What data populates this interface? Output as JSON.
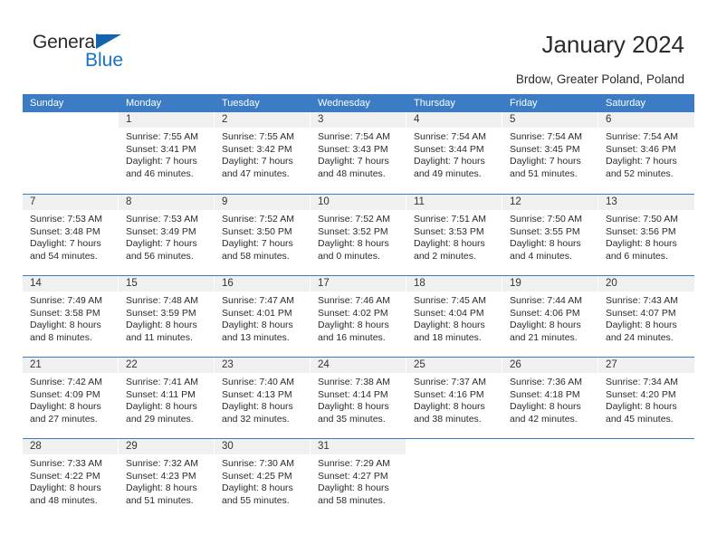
{
  "logo": {
    "text_top": "General",
    "text_bottom": "Blue",
    "triangle_icon": "blue-triangle-icon",
    "color_dark": "#2b2b2b",
    "color_blue": "#1575c4"
  },
  "header": {
    "title": "January 2024",
    "location": "Brdow, Greater Poland, Poland"
  },
  "calendar": {
    "header_bg": "#3b7cc4",
    "header_text_color": "#ffffff",
    "daynum_bg": "#f0f0f0",
    "weekdays": [
      "Sunday",
      "Monday",
      "Tuesday",
      "Wednesday",
      "Thursday",
      "Friday",
      "Saturday"
    ],
    "weeks": [
      [
        {
          "day": "",
          "lines": []
        },
        {
          "day": "1",
          "lines": [
            "Sunrise: 7:55 AM",
            "Sunset: 3:41 PM",
            "Daylight: 7 hours",
            "and 46 minutes."
          ]
        },
        {
          "day": "2",
          "lines": [
            "Sunrise: 7:55 AM",
            "Sunset: 3:42 PM",
            "Daylight: 7 hours",
            "and 47 minutes."
          ]
        },
        {
          "day": "3",
          "lines": [
            "Sunrise: 7:54 AM",
            "Sunset: 3:43 PM",
            "Daylight: 7 hours",
            "and 48 minutes."
          ]
        },
        {
          "day": "4",
          "lines": [
            "Sunrise: 7:54 AM",
            "Sunset: 3:44 PM",
            "Daylight: 7 hours",
            "and 49 minutes."
          ]
        },
        {
          "day": "5",
          "lines": [
            "Sunrise: 7:54 AM",
            "Sunset: 3:45 PM",
            "Daylight: 7 hours",
            "and 51 minutes."
          ]
        },
        {
          "day": "6",
          "lines": [
            "Sunrise: 7:54 AM",
            "Sunset: 3:46 PM",
            "Daylight: 7 hours",
            "and 52 minutes."
          ]
        }
      ],
      [
        {
          "day": "7",
          "lines": [
            "Sunrise: 7:53 AM",
            "Sunset: 3:48 PM",
            "Daylight: 7 hours",
            "and 54 minutes."
          ]
        },
        {
          "day": "8",
          "lines": [
            "Sunrise: 7:53 AM",
            "Sunset: 3:49 PM",
            "Daylight: 7 hours",
            "and 56 minutes."
          ]
        },
        {
          "day": "9",
          "lines": [
            "Sunrise: 7:52 AM",
            "Sunset: 3:50 PM",
            "Daylight: 7 hours",
            "and 58 minutes."
          ]
        },
        {
          "day": "10",
          "lines": [
            "Sunrise: 7:52 AM",
            "Sunset: 3:52 PM",
            "Daylight: 8 hours",
            "and 0 minutes."
          ]
        },
        {
          "day": "11",
          "lines": [
            "Sunrise: 7:51 AM",
            "Sunset: 3:53 PM",
            "Daylight: 8 hours",
            "and 2 minutes."
          ]
        },
        {
          "day": "12",
          "lines": [
            "Sunrise: 7:50 AM",
            "Sunset: 3:55 PM",
            "Daylight: 8 hours",
            "and 4 minutes."
          ]
        },
        {
          "day": "13",
          "lines": [
            "Sunrise: 7:50 AM",
            "Sunset: 3:56 PM",
            "Daylight: 8 hours",
            "and 6 minutes."
          ]
        }
      ],
      [
        {
          "day": "14",
          "lines": [
            "Sunrise: 7:49 AM",
            "Sunset: 3:58 PM",
            "Daylight: 8 hours",
            "and 8 minutes."
          ]
        },
        {
          "day": "15",
          "lines": [
            "Sunrise: 7:48 AM",
            "Sunset: 3:59 PM",
            "Daylight: 8 hours",
            "and 11 minutes."
          ]
        },
        {
          "day": "16",
          "lines": [
            "Sunrise: 7:47 AM",
            "Sunset: 4:01 PM",
            "Daylight: 8 hours",
            "and 13 minutes."
          ]
        },
        {
          "day": "17",
          "lines": [
            "Sunrise: 7:46 AM",
            "Sunset: 4:02 PM",
            "Daylight: 8 hours",
            "and 16 minutes."
          ]
        },
        {
          "day": "18",
          "lines": [
            "Sunrise: 7:45 AM",
            "Sunset: 4:04 PM",
            "Daylight: 8 hours",
            "and 18 minutes."
          ]
        },
        {
          "day": "19",
          "lines": [
            "Sunrise: 7:44 AM",
            "Sunset: 4:06 PM",
            "Daylight: 8 hours",
            "and 21 minutes."
          ]
        },
        {
          "day": "20",
          "lines": [
            "Sunrise: 7:43 AM",
            "Sunset: 4:07 PM",
            "Daylight: 8 hours",
            "and 24 minutes."
          ]
        }
      ],
      [
        {
          "day": "21",
          "lines": [
            "Sunrise: 7:42 AM",
            "Sunset: 4:09 PM",
            "Daylight: 8 hours",
            "and 27 minutes."
          ]
        },
        {
          "day": "22",
          "lines": [
            "Sunrise: 7:41 AM",
            "Sunset: 4:11 PM",
            "Daylight: 8 hours",
            "and 29 minutes."
          ]
        },
        {
          "day": "23",
          "lines": [
            "Sunrise: 7:40 AM",
            "Sunset: 4:13 PM",
            "Daylight: 8 hours",
            "and 32 minutes."
          ]
        },
        {
          "day": "24",
          "lines": [
            "Sunrise: 7:38 AM",
            "Sunset: 4:14 PM",
            "Daylight: 8 hours",
            "and 35 minutes."
          ]
        },
        {
          "day": "25",
          "lines": [
            "Sunrise: 7:37 AM",
            "Sunset: 4:16 PM",
            "Daylight: 8 hours",
            "and 38 minutes."
          ]
        },
        {
          "day": "26",
          "lines": [
            "Sunrise: 7:36 AM",
            "Sunset: 4:18 PM",
            "Daylight: 8 hours",
            "and 42 minutes."
          ]
        },
        {
          "day": "27",
          "lines": [
            "Sunrise: 7:34 AM",
            "Sunset: 4:20 PM",
            "Daylight: 8 hours",
            "and 45 minutes."
          ]
        }
      ],
      [
        {
          "day": "28",
          "lines": [
            "Sunrise: 7:33 AM",
            "Sunset: 4:22 PM",
            "Daylight: 8 hours",
            "and 48 minutes."
          ]
        },
        {
          "day": "29",
          "lines": [
            "Sunrise: 7:32 AM",
            "Sunset: 4:23 PM",
            "Daylight: 8 hours",
            "and 51 minutes."
          ]
        },
        {
          "day": "30",
          "lines": [
            "Sunrise: 7:30 AM",
            "Sunset: 4:25 PM",
            "Daylight: 8 hours",
            "and 55 minutes."
          ]
        },
        {
          "day": "31",
          "lines": [
            "Sunrise: 7:29 AM",
            "Sunset: 4:27 PM",
            "Daylight: 8 hours",
            "and 58 minutes."
          ]
        },
        {
          "day": "",
          "lines": []
        },
        {
          "day": "",
          "lines": []
        },
        {
          "day": "",
          "lines": []
        }
      ]
    ]
  }
}
